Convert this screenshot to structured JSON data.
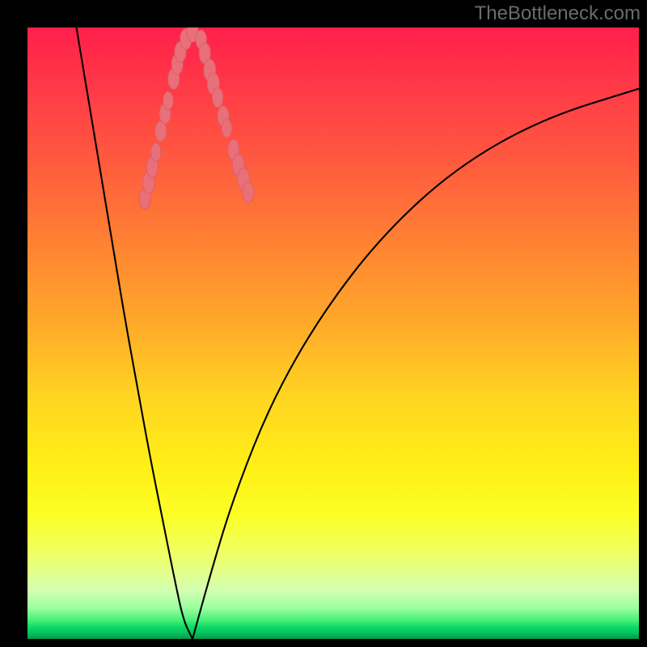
{
  "watermark": "TheBottleneck.com",
  "colors": {
    "background": "#000000",
    "curve_stroke": "#000000",
    "bead_fill": "#e96f78",
    "bead_stroke": "#da5e67"
  },
  "chart_data": {
    "type": "line",
    "title": "",
    "xlabel": "",
    "ylabel": "",
    "xlim": [
      0,
      100
    ],
    "ylim": [
      0,
      100
    ],
    "grid": false,
    "legend": false,
    "series": [
      {
        "name": "left-branch",
        "x": [
          8,
          10,
          12,
          14,
          16,
          18,
          20,
          22,
          24,
          25.5,
          27
        ],
        "y": [
          100,
          88,
          76,
          64,
          52,
          41,
          30,
          20,
          10,
          3,
          0
        ]
      },
      {
        "name": "right-branch",
        "x": [
          27,
          30,
          34,
          40,
          48,
          58,
          70,
          84,
          100
        ],
        "y": [
          0,
          11,
          24,
          39,
          53,
          66,
          77,
          85,
          90
        ]
      }
    ],
    "beads": {
      "name": "beads",
      "points": [
        {
          "x": 19.2,
          "y": 72.0,
          "r": 1.7
        },
        {
          "x": 19.8,
          "y": 74.6,
          "r": 1.8
        },
        {
          "x": 20.4,
          "y": 77.2,
          "r": 1.7
        },
        {
          "x": 21.0,
          "y": 79.6,
          "r": 1.5
        },
        {
          "x": 21.8,
          "y": 83.0,
          "r": 1.7
        },
        {
          "x": 22.5,
          "y": 85.9,
          "r": 1.7
        },
        {
          "x": 23.0,
          "y": 88.0,
          "r": 1.5
        },
        {
          "x": 23.9,
          "y": 91.6,
          "r": 1.7
        },
        {
          "x": 24.5,
          "y": 94.0,
          "r": 1.7
        },
        {
          "x": 25.0,
          "y": 96.0,
          "r": 1.7
        },
        {
          "x": 25.9,
          "y": 98.1,
          "r": 1.7
        },
        {
          "x": 27.0,
          "y": 99.3,
          "r": 1.7
        },
        {
          "x": 28.4,
          "y": 98.0,
          "r": 1.6
        },
        {
          "x": 29.0,
          "y": 95.8,
          "r": 1.7
        },
        {
          "x": 29.8,
          "y": 93.0,
          "r": 1.8
        },
        {
          "x": 30.4,
          "y": 90.8,
          "r": 1.8
        },
        {
          "x": 31.1,
          "y": 88.5,
          "r": 1.6
        },
        {
          "x": 32.0,
          "y": 85.5,
          "r": 1.7
        },
        {
          "x": 32.6,
          "y": 83.5,
          "r": 1.5
        },
        {
          "x": 33.7,
          "y": 80.0,
          "r": 1.7
        },
        {
          "x": 34.5,
          "y": 77.5,
          "r": 1.8
        },
        {
          "x": 35.3,
          "y": 75.2,
          "r": 1.8
        },
        {
          "x": 36.1,
          "y": 73.0,
          "r": 1.7
        }
      ]
    }
  }
}
